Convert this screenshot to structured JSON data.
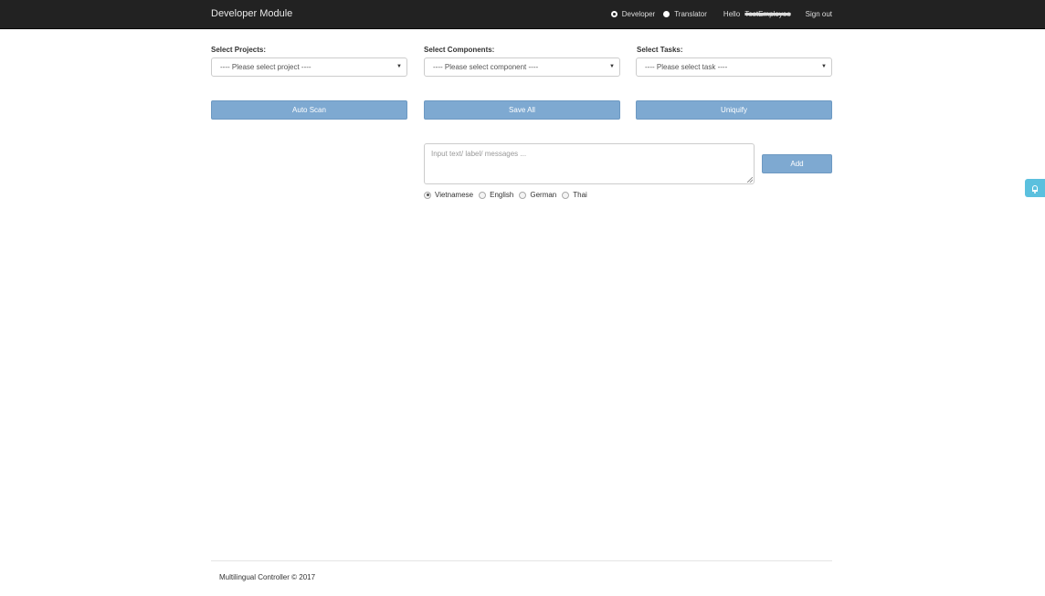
{
  "navbar": {
    "brand": "Developer Module",
    "roles": [
      {
        "label": "Developer",
        "selected": true
      },
      {
        "label": "Translator",
        "selected": false
      }
    ],
    "hello_label": "Hello",
    "user_name": "TestEmployee",
    "signout_label": "Sign out"
  },
  "filters": {
    "projects": {
      "label": "Select Projects:",
      "value": "---- Please select project ----"
    },
    "components": {
      "label": "Select Components:",
      "value": "---- Please select component ----"
    },
    "tasks": {
      "label": "Select Tasks:",
      "value": "---- Please select task ----"
    }
  },
  "actions": {
    "auto_scan": "Auto Scan",
    "save_all": "Save All",
    "uniquify": "Uniquify"
  },
  "message_input": {
    "placeholder": "Input text/ label/ messages ...",
    "add_label": "Add"
  },
  "languages": [
    {
      "label": "Vietnamese",
      "selected": true
    },
    {
      "label": "English",
      "selected": false
    },
    {
      "label": "German",
      "selected": false
    },
    {
      "label": "Thai",
      "selected": false
    }
  ],
  "footer": {
    "text": "Multilingual Controller © 2017"
  },
  "colors": {
    "navbar_bg": "#222222",
    "button_bg": "#7ea9d1",
    "notify_bg": "#5bc0de"
  }
}
